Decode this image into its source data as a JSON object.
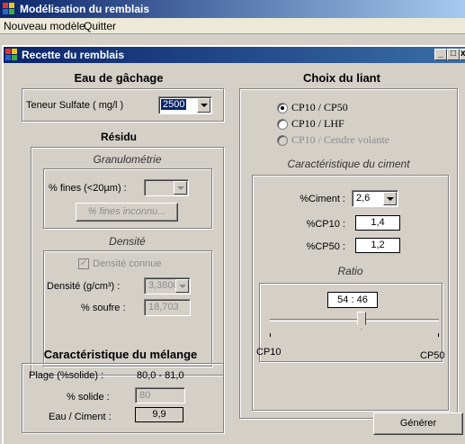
{
  "window": {
    "title": "Modélisation du remblais"
  },
  "menu": {
    "items": [
      "Nouveau modèle",
      "Quitter"
    ]
  },
  "child_window": {
    "title": "Recette du remblais"
  },
  "eau": {
    "heading": "Eau de gâchage",
    "sulfate_label": "Teneur Sulfate ( mg/l )",
    "sulfate_value": "2500"
  },
  "residu": {
    "heading": "Résidu",
    "granulo_heading": "Granulométrie",
    "fines_label": "% fines (<20µm) :",
    "fines_value": "",
    "fines_button": "% fines inconnu...",
    "densite_heading": "Densité",
    "densite_checkbox": "Densité connue",
    "densite_label": "Densité (g/cm³) :",
    "densite_value": "3,3800",
    "soufre_label": "% soufre :",
    "soufre_value": "18,703"
  },
  "melange": {
    "heading": "Caractéristique  du mélange",
    "plage_label": "Plage (%solide) :",
    "plage_value": "80,0 - 81,0",
    "solide_label": "% solide :",
    "solide_value": "80",
    "eau_ciment_label": "Eau / Ciment :",
    "eau_ciment_value": "9,9"
  },
  "liant": {
    "heading": "Choix du liant",
    "options": [
      "CP10 / CP50",
      "CP10 / LHF",
      "CP10 / Cendre volante"
    ],
    "ciment_heading": "Caractéristique du ciment",
    "ciment_label": "%Ciment :",
    "ciment_value": "2,6",
    "cp10_label": "%CP10 :",
    "cp10_value": "1,4",
    "cp50_label": "%CP50 :",
    "cp50_value": "1,2",
    "ratio_heading": "Ratio",
    "ratio_value": "54 : 46",
    "ratio_fraction": 0.54,
    "slider_left": "CP10",
    "slider_right": "CP50"
  },
  "actions": {
    "generate_label": "Générer"
  }
}
